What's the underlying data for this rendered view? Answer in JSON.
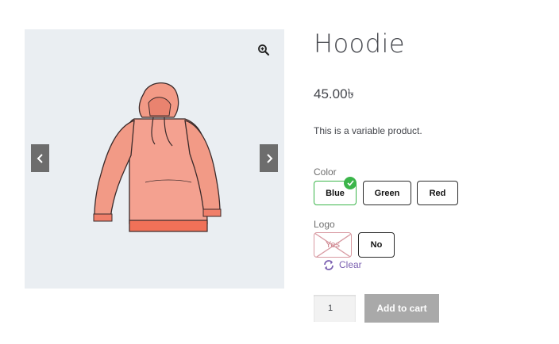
{
  "product": {
    "title": "Hoodie",
    "price": "45.00৳",
    "description": "This is a variable product.",
    "image_icon": "hoodie-image"
  },
  "gallery": {
    "zoom_icon": "magnifier-plus-icon",
    "prev_icon": "chevron-left-icon",
    "next_icon": "chevron-right-icon"
  },
  "attributes": {
    "color": {
      "label": "Color",
      "options": [
        "Blue",
        "Green",
        "Red"
      ],
      "selected": "Blue"
    },
    "logo": {
      "label": "Logo",
      "options": [
        "Yes",
        "No"
      ],
      "disabled": [
        "Yes"
      ]
    }
  },
  "clear_label": "Clear",
  "cart": {
    "quantity": "1",
    "add_to_cart_label": "Add to cart"
  },
  "colors": {
    "selected_border": "#3bb54a",
    "clear_link": "#7a5fb0",
    "button_disabled": "#a9a9a9"
  }
}
